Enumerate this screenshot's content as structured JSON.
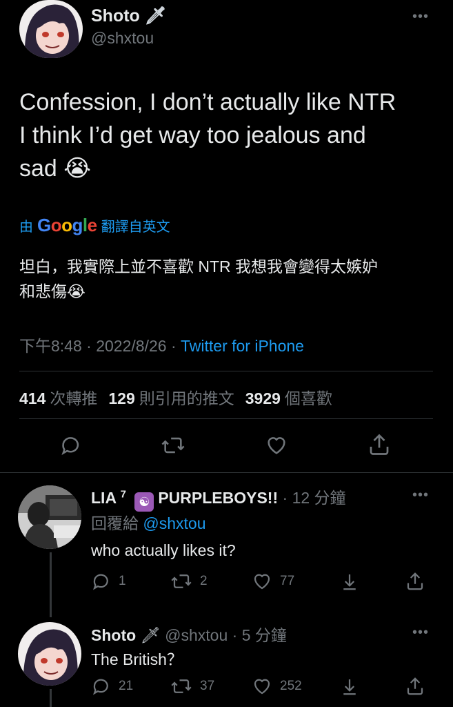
{
  "main_tweet": {
    "author_name": "Shoto",
    "name_emoji": "🗡",
    "handle": "@shxtou",
    "more": "•••",
    "text": "Confession, I don’t actually like NTR\nI think I’d get way too jealous and\nsad 😭",
    "translate": {
      "prefix": "由",
      "brand": "Google",
      "suffix": "翻譯自英文"
    },
    "translated_text": "坦白，我實際上並不喜歡 NTR 我想我會變得太嫉妒\n和悲傷😭",
    "time": "下午8:48",
    "date": "2022/8/26",
    "sep": "·",
    "source": "Twitter for iPhone",
    "stats": [
      {
        "count": "414",
        "label": "次轉推"
      },
      {
        "count": "129",
        "label": "則引用的推文"
      },
      {
        "count": "3929",
        "label": "個喜歡"
      }
    ]
  },
  "replies": [
    {
      "name": "LIA",
      "superscript": "7",
      "badge_glyph": "☯",
      "name_tail": "PURPLEBOYS!!",
      "time_ago": "· 12 分鐘",
      "reply_to_prefix": "回覆給",
      "reply_to_handle": "@shxtou",
      "text": "who actually likes it?",
      "replies": "1",
      "retweets": "2",
      "likes": "77",
      "more": "•••"
    },
    {
      "name": "Shoto",
      "name_emoji": "🗡",
      "handle": "@shxtou",
      "time_ago": "· 5 分鐘",
      "text": "The British？",
      "replies": "21",
      "retweets": "37",
      "likes": "252",
      "more": "•••"
    }
  ],
  "colors": {
    "background": "#000000",
    "text": "#e7e9ea",
    "muted": "#71767b",
    "accent": "#1d9bf0",
    "divider": "#2f3336"
  }
}
